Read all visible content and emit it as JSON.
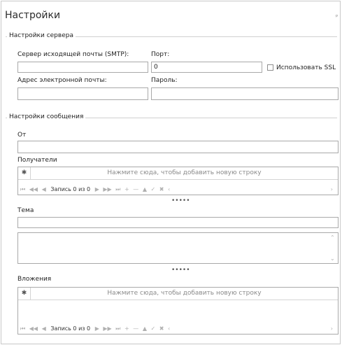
{
  "panel": {
    "title": "Настройки",
    "pin_icon": "ᵖ"
  },
  "server": {
    "legend": "Настройки сервера",
    "smtp_label": "Сервер исходящей почты (SMTP):",
    "smtp_value": "",
    "port_label": "Порт:",
    "port_value": "0",
    "ssl_label": "Использовать SSL",
    "ssl_checked": false,
    "email_label": "Адрес электронной почты:",
    "email_value": "",
    "password_label": "Пароль:",
    "password_value": ""
  },
  "message": {
    "legend": "Настройки сообщения",
    "from_label": "От",
    "from_value": "",
    "recipients_label": "Получатели",
    "recipients_new_row": "Нажмите сюда, чтобы добавить новую строку",
    "recipients_nav": "Запись 0 из 0",
    "subject_label": "Тема",
    "subject_value": "",
    "body_value": "",
    "attachments_label": "Вложения",
    "attachments_new_row": "Нажмите сюда, чтобы добавить новую строку",
    "attachments_nav": "Запись 0 из 0"
  },
  "glyphs": {
    "star": "✱",
    "first": "⏮",
    "prev_page": "◀◀",
    "prev": "◀",
    "next": "▶",
    "next_page": "▶▶",
    "last": "⏭",
    "add": "+",
    "remove": "—",
    "up": "▲",
    "check": "✓",
    "cancel": "✖",
    "scroll_left": "‹",
    "scroll_right": "›",
    "scroll_up": "⌃",
    "scroll_down": "⌄",
    "splitter": "•••••"
  }
}
